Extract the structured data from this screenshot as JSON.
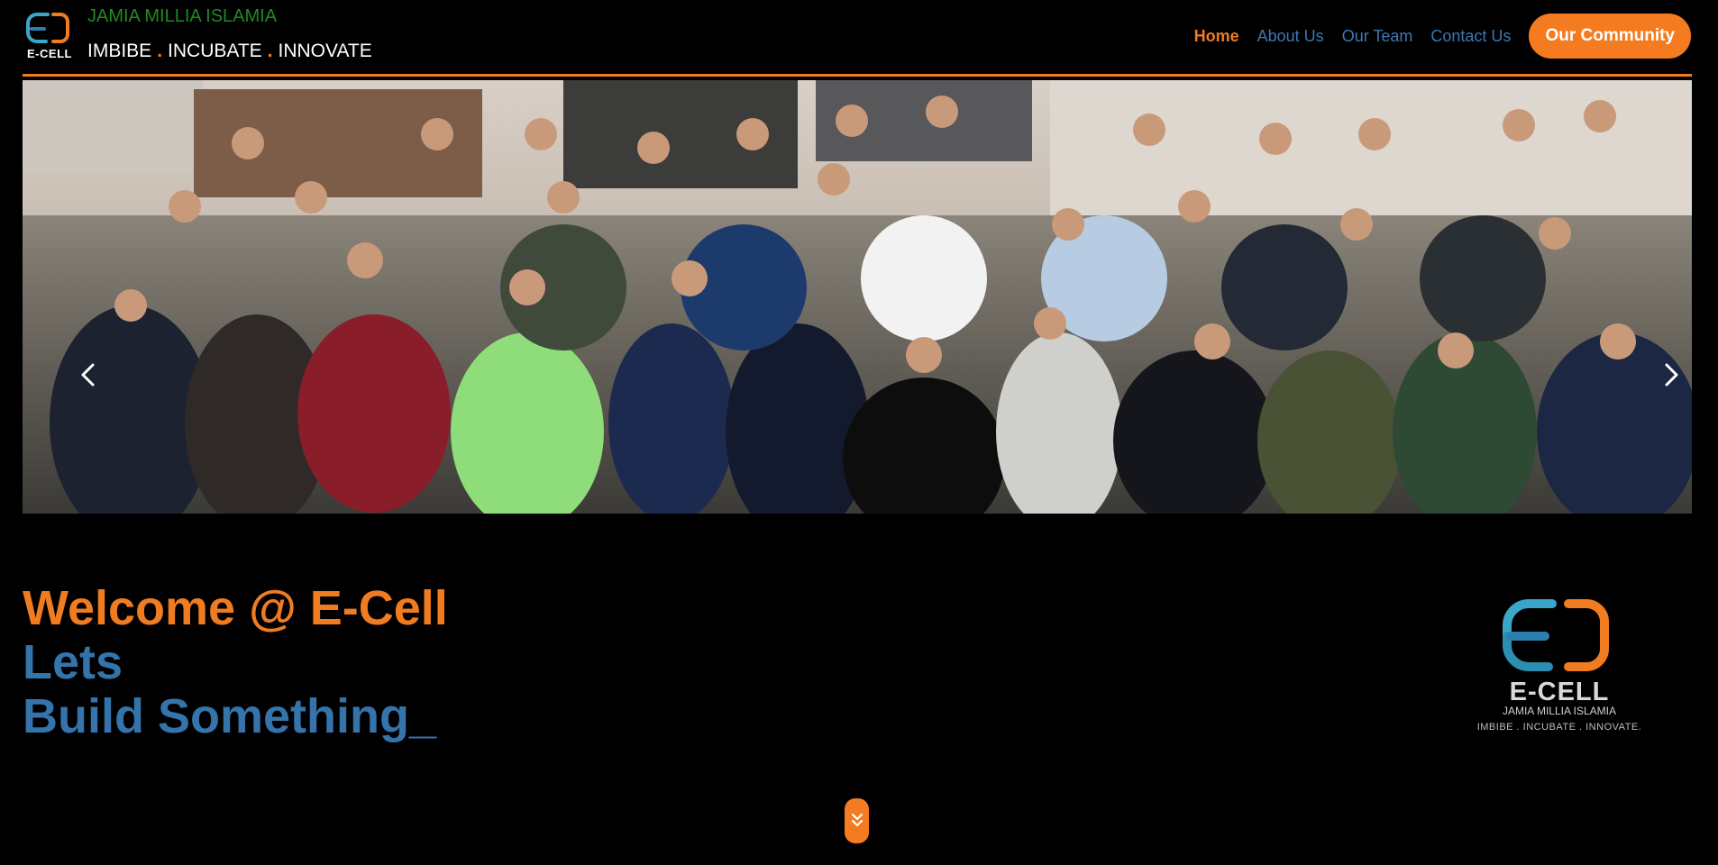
{
  "brand": {
    "name": "JAMIA MILLIA ISLAMIA",
    "logo_word": "E-CELL",
    "tagline_parts": [
      "IMBIBE",
      "INCUBATE",
      "INNOVATE"
    ],
    "tagline_separator": "."
  },
  "nav": {
    "items": [
      {
        "label": "Home",
        "active": true
      },
      {
        "label": "About Us",
        "active": false
      },
      {
        "label": "Our Team",
        "active": false
      },
      {
        "label": "Contact Us",
        "active": false
      }
    ],
    "cta_label": "Our Community"
  },
  "carousel": {
    "slide_count": 5,
    "active_index": 0,
    "photo_icon": "group-photo"
  },
  "welcome": {
    "line1": "Welcome @ E-Cell",
    "line2": "Lets",
    "line3": "Build Something_"
  },
  "side_logo": {
    "word": "E-CELL",
    "subtitle": "JAMIA MILLIA ISLAMIA",
    "tagline": "IMBIBE . INCUBATE . INNOVATE."
  },
  "colors": {
    "accent": "#f07c21",
    "nav_link": "#3d78b4",
    "brand_green": "#1f8a1f",
    "heading_blue": "#3474ab"
  },
  "icons": {
    "scroll": "double-chevron-down",
    "prev": "chevron-left",
    "next": "chevron-right"
  }
}
